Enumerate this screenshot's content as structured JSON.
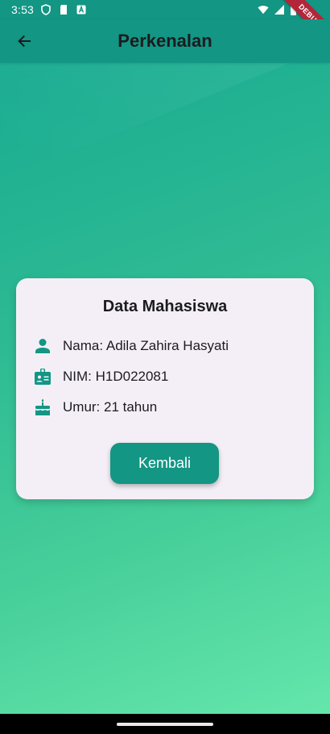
{
  "status_bar": {
    "time": "3:53",
    "debug_label": "DEBUG"
  },
  "app_bar": {
    "title": "Perkenalan"
  },
  "card": {
    "title": "Data Mahasiswa",
    "rows": [
      {
        "icon": "person-icon",
        "text": "Nama: Adila Zahira Hasyati"
      },
      {
        "icon": "badge-icon",
        "text": "NIM: H1D022081"
      },
      {
        "icon": "cake-icon",
        "text": "Umur: 21 tahun"
      }
    ],
    "button_label": "Kembali"
  },
  "colors": {
    "primary": "#139684",
    "card_background": "#f4eff6",
    "gradient_start": "#14a892",
    "gradient_end": "#67e8ad",
    "debug_ribbon": "#b3263a"
  }
}
